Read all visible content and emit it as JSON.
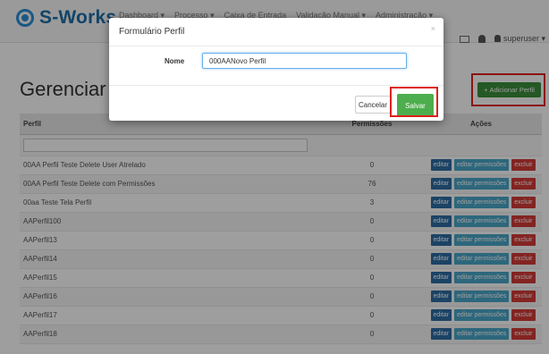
{
  "header": {
    "logo_text": "S-Works",
    "nav": [
      "Dashboard ▾",
      "Processo ▾",
      "Caixa de Entrada",
      "Validação Manual ▾",
      "Administração ▾"
    ],
    "user": "superuser ▾"
  },
  "page": {
    "title": "Gerenciar Perfis",
    "add_button": "Adicionar Perfil",
    "add_icon": "+"
  },
  "table": {
    "headers": [
      "Perfil",
      "Permissões",
      "Ações"
    ],
    "actions": {
      "edit": "editar",
      "edit_perms": "editar permissões",
      "delete": "excluir"
    },
    "rows": [
      {
        "name": "00AA Perfil Teste Delete User Atrelado",
        "perms": "0"
      },
      {
        "name": "00AA Perfil Teste Delete com Permissões",
        "perms": "76"
      },
      {
        "name": "00aa Teste Tela Perfil",
        "perms": "3"
      },
      {
        "name": "AAPerfil100",
        "perms": "0"
      },
      {
        "name": "AAPerfil13",
        "perms": "0"
      },
      {
        "name": "AAPerfil14",
        "perms": "0"
      },
      {
        "name": "AAPerfil15",
        "perms": "0"
      },
      {
        "name": "AAPerfil16",
        "perms": "0"
      },
      {
        "name": "AAPerfil17",
        "perms": "0"
      },
      {
        "name": "AAPerfil18",
        "perms": "0"
      }
    ]
  },
  "modal": {
    "title": "Formulário Perfil",
    "close": "×",
    "field_label": "Nome",
    "field_value": "000AANovo Perfil",
    "cancel": "Cancelar",
    "save": "Salvar"
  },
  "colors": {
    "brand": "#1d6fa8",
    "success": "#4cae4c",
    "primary": "#2e6da4",
    "info": "#4aa6c8",
    "danger": "#d33b37",
    "highlight": "#e0201a"
  }
}
